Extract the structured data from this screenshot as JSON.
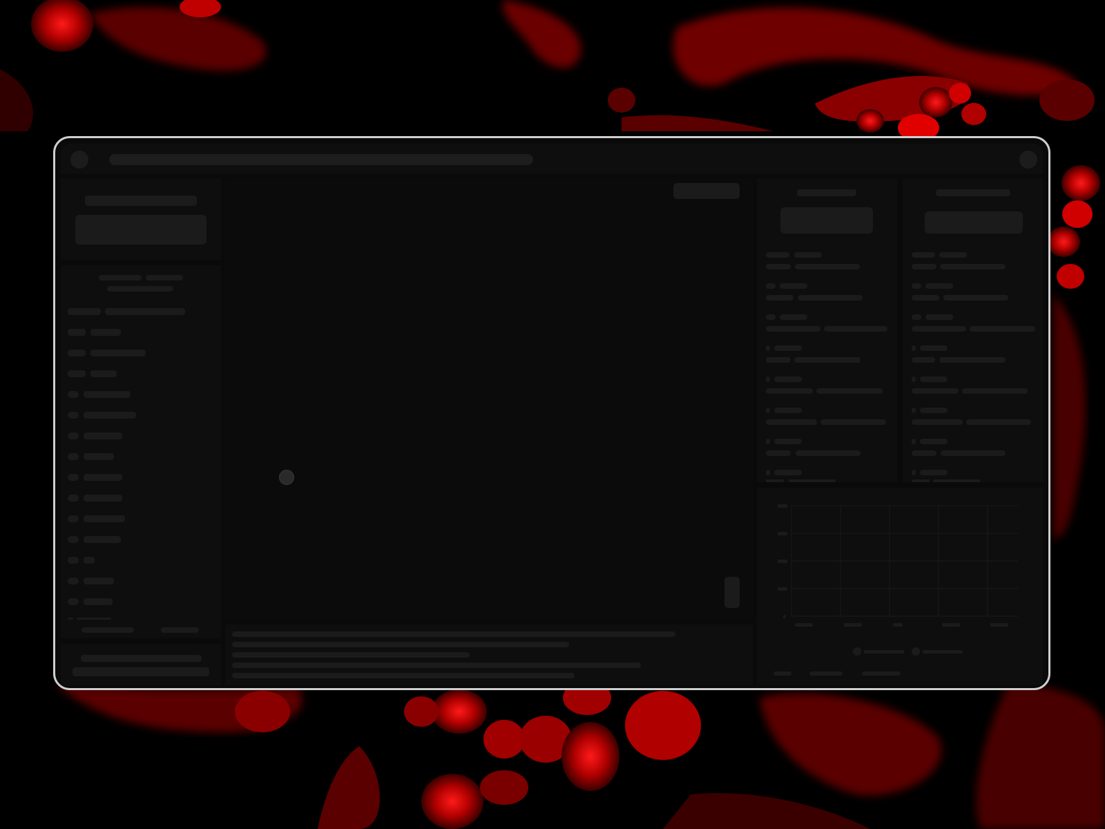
{
  "window": {
    "controls": {
      "left_icon": "circle-icon",
      "right_icon": "circle-icon"
    }
  },
  "colors": {
    "background": "#000000",
    "window_border": "#cfcfcf",
    "panel": "#0e0e0e",
    "skeleton": "#1b1b1b",
    "accent_red": "#c00000"
  }
}
